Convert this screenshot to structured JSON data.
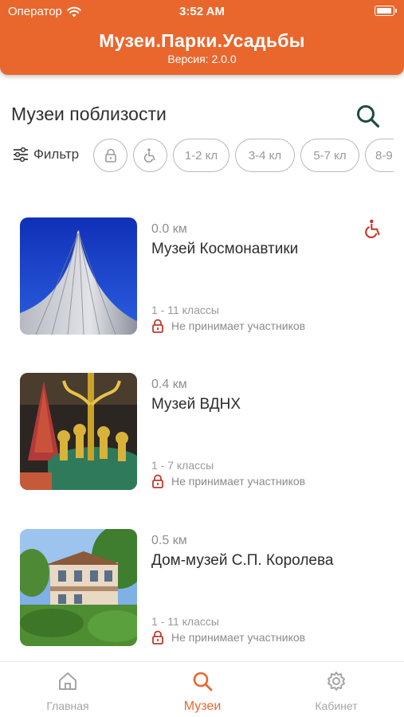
{
  "status_bar": {
    "carrier": "Оператор",
    "time": "3:52 AM"
  },
  "header": {
    "title": "Музеи.Парки.Усадьбы",
    "version": "Версия: 2.0.0",
    "color": "#e9672d"
  },
  "section": {
    "title": "Музеи поблизости"
  },
  "filters": {
    "label": "Фильтр",
    "chips": [
      {
        "icon": "lock-icon",
        "label": ""
      },
      {
        "icon": "wheelchair-icon",
        "label": ""
      },
      {
        "label": "1-2 кл"
      },
      {
        "label": "3-4 кл"
      },
      {
        "label": "5-7 кл"
      },
      {
        "label": "8-9"
      }
    ]
  },
  "museums": [
    {
      "distance": "0.0 км",
      "name": "Музей Космонавтики",
      "grades": "1 - 11 классы",
      "access": "Не принимает участников",
      "wheelchair": true
    },
    {
      "distance": "0.4 км",
      "name": "Музей ВДНХ",
      "grades": "1 - 7 классы",
      "access": "Не принимает участников",
      "wheelchair": false
    },
    {
      "distance": "0.5 км",
      "name": "Дом-музей С.П. Королева",
      "grades": "1 - 11 классы",
      "access": "Не принимает участников",
      "wheelchair": false
    }
  ],
  "tabs": [
    {
      "icon": "home-icon",
      "label": "Главная",
      "active": false
    },
    {
      "icon": "search-icon",
      "label": "Музеи",
      "active": true
    },
    {
      "icon": "gear-icon",
      "label": "Кабинет",
      "active": false
    }
  ]
}
